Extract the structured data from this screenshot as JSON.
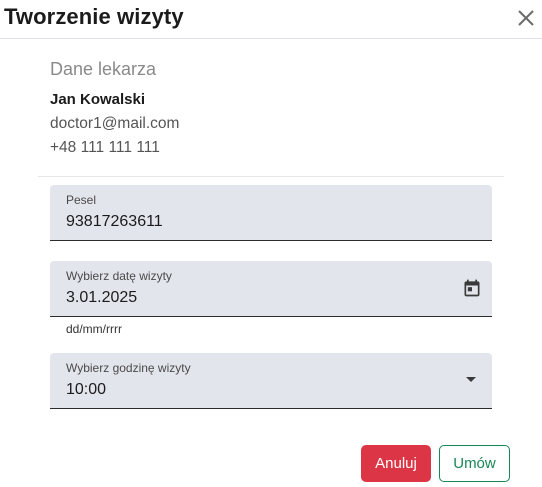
{
  "dialog": {
    "title": "Tworzenie wizyty"
  },
  "doctor": {
    "section_title": "Dane lekarza",
    "name": "Jan Kowalski",
    "email": "doctor1@mail.com",
    "phone": "+48 111 111 111"
  },
  "form": {
    "pesel": {
      "label": "Pesel",
      "value": "93817263611"
    },
    "date": {
      "label": "Wybierz datę wizyty",
      "value": "3.01.2025",
      "hint": "dd/mm/rrrr",
      "icon": "calendar-icon"
    },
    "time": {
      "label": "Wybierz godzinę wizyty",
      "value": "10:00",
      "icon": "dropdown-caret-icon"
    }
  },
  "actions": {
    "cancel_label": "Anuluj",
    "submit_label": "Umów"
  },
  "colors": {
    "cancel": "#dc3545",
    "submit": "#198754",
    "field_bg": "#e3e5ec"
  }
}
